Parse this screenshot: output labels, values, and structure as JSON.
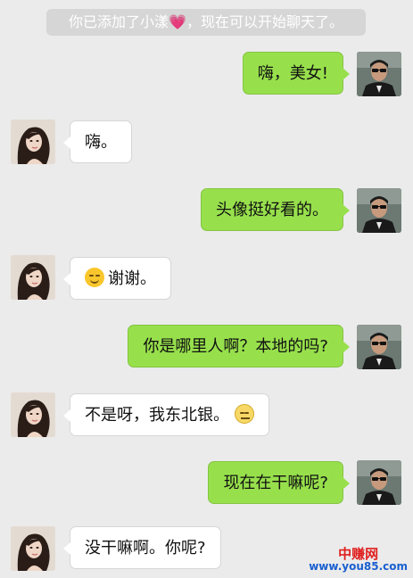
{
  "system_notice": {
    "prefix": "你已添加了小漾",
    "suffix": "，现在可以开始聊天了。",
    "emoji": "pink-heart-emoji"
  },
  "messages": [
    {
      "from": "self",
      "text": "嗨，美女!"
    },
    {
      "from": "other",
      "text": "嗨。"
    },
    {
      "from": "self",
      "text": "头像挺好看的。"
    },
    {
      "from": "other",
      "text": "谢谢。",
      "emoji_before": "smile-emoji"
    },
    {
      "from": "self",
      "text": "你是哪里人啊？本地的吗?"
    },
    {
      "from": "other",
      "text": "不是呀，我东北银。",
      "emoji_after": "neutral-face-emoji"
    },
    {
      "from": "self",
      "text": "现在在干嘛呢?"
    },
    {
      "from": "other",
      "text": "没干嘛啊。你呢?"
    }
  ],
  "watermark": {
    "logo": "中赚网",
    "url": "www.you85.com"
  },
  "colors": {
    "self_bubble": "#97e04c",
    "other_bubble": "#ffffff",
    "background": "#ebebeb",
    "notice_bg": "#d6d6d6"
  }
}
